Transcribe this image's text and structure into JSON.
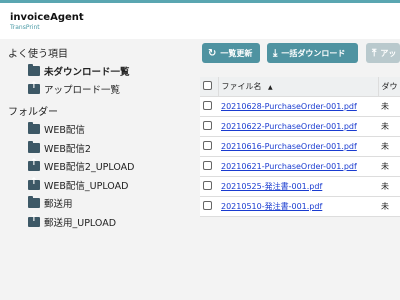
{
  "app": {
    "title": "invoiceAgent",
    "subtitle": "TransPrint"
  },
  "sidebar": {
    "favorites_heading": "よく使う項目",
    "favorites": [
      {
        "label": "未ダウンロード一覧",
        "icon": "folder-icon"
      },
      {
        "label": "アップロード一覧",
        "icon": "upload-folder-icon"
      }
    ],
    "folders_heading": "フォルダー",
    "folders": [
      {
        "label": "WEB配信",
        "icon": "folder-icon"
      },
      {
        "label": "WEB配信2",
        "icon": "folder-icon"
      },
      {
        "label": "WEB配信2_UPLOAD",
        "icon": "upload-folder-icon"
      },
      {
        "label": "WEB配信_UPLOAD",
        "icon": "upload-folder-icon"
      },
      {
        "label": "郵送用",
        "icon": "folder-icon"
      },
      {
        "label": "郵送用_UPLOAD",
        "icon": "upload-folder-icon"
      }
    ]
  },
  "toolbar": {
    "refresh_label": "一覧更新",
    "bulk_download_label": "一括ダウンロード",
    "upload_label": "アッ"
  },
  "table": {
    "columns": [
      "ファイル名",
      "ダウ"
    ],
    "sort_indicator": "▲",
    "rows": [
      {
        "filename": "20210628-PurchaseOrder-001.pdf",
        "status": "未"
      },
      {
        "filename": "20210622-PurchaseOrder-001.pdf",
        "status": "未"
      },
      {
        "filename": "20210616-PurchaseOrder-001.pdf",
        "status": "未"
      },
      {
        "filename": "20210621-PurchaseOrder-001.pdf",
        "status": "未"
      },
      {
        "filename": "20210525-発注書-001.pdf",
        "status": "未"
      },
      {
        "filename": "20210510-発注書-001.pdf",
        "status": "未"
      }
    ]
  },
  "colors": {
    "accent": "#4f93a1",
    "link": "#1a3cd0",
    "icon": "#3d5866"
  }
}
